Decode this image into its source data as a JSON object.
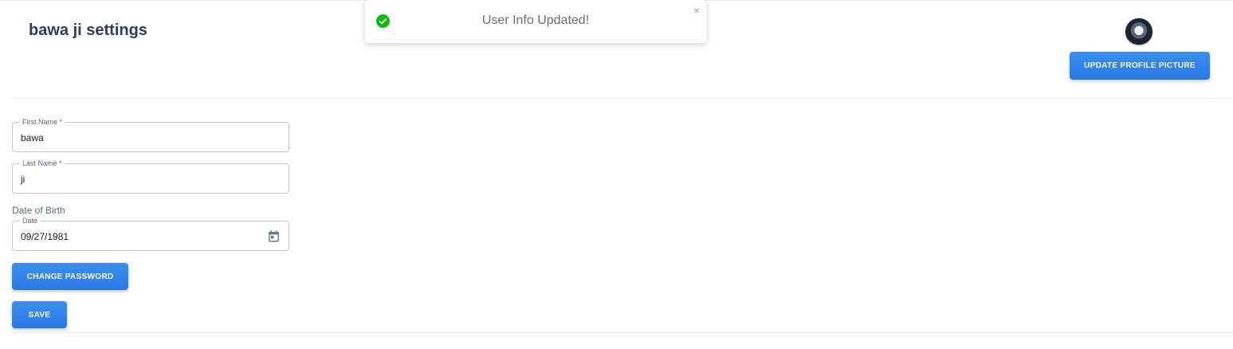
{
  "header": {
    "title": "bawa ji settings",
    "upload_button": "UPDATE PROFILE PICTURE"
  },
  "toast": {
    "message": "User Info Updated!",
    "close_glyph": "×",
    "icon": "check-circle-icon",
    "color": "#07bc0c"
  },
  "form": {
    "first_name": {
      "label": "First Name *",
      "value": "bawa"
    },
    "last_name": {
      "label": "Last Name *",
      "value": "ji"
    },
    "dob_label": "Date of Birth",
    "date": {
      "label": "Date",
      "value": "09/27/1981",
      "icon": "calendar-icon"
    }
  },
  "actions": {
    "change_password": "CHANGE PASSWORD",
    "save": "SAVE"
  },
  "colors": {
    "accent": "#2a78e6",
    "title": "#2c3e5c"
  }
}
